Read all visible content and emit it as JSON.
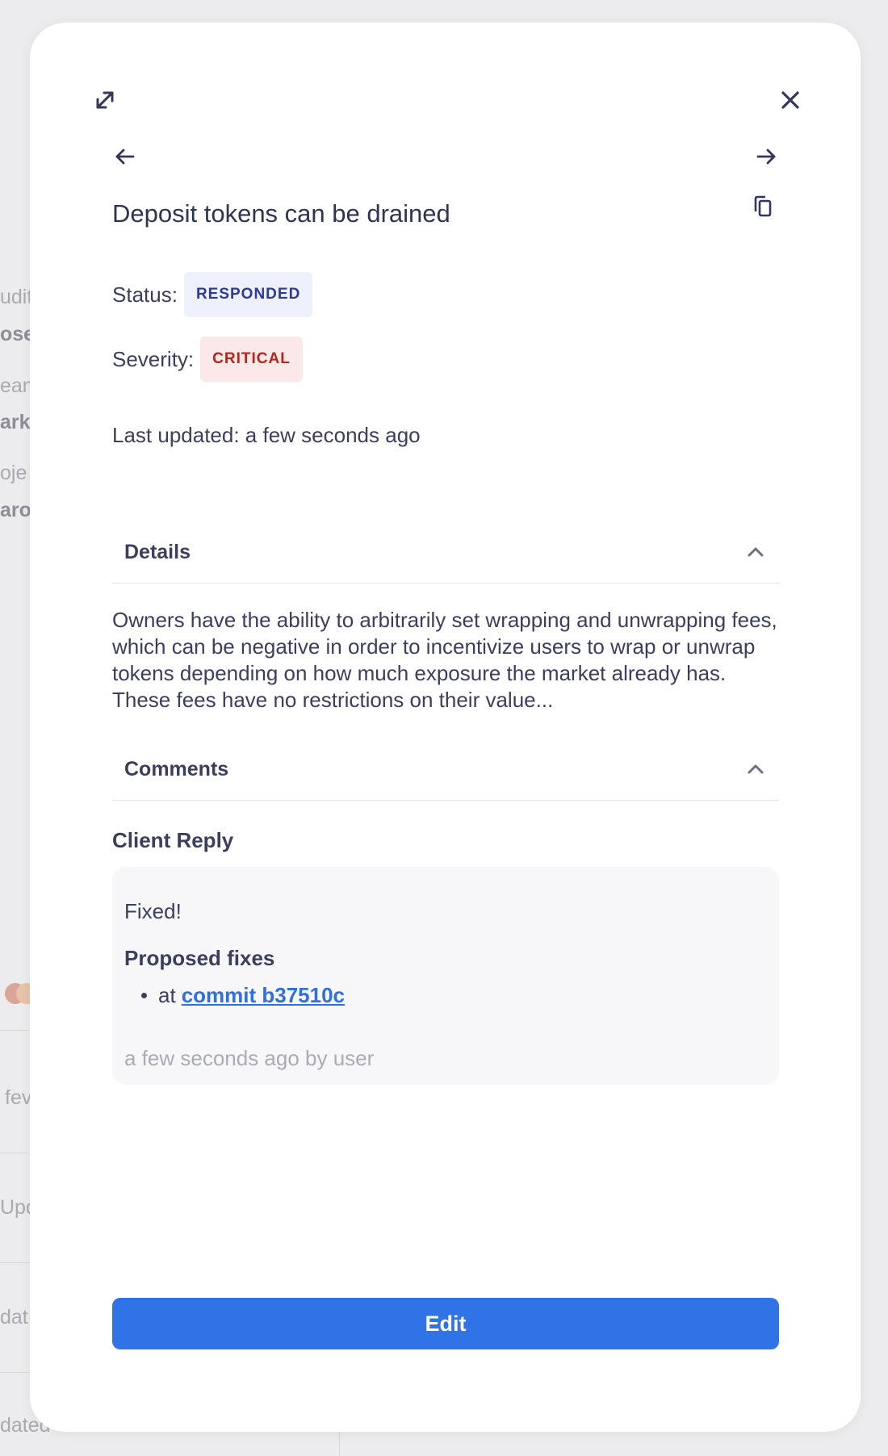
{
  "background": {
    "fragments": [
      "udit",
      "ose",
      "eam",
      "ark",
      "oje",
      "aro",
      "fev",
      "Upd",
      "dat",
      "dated"
    ]
  },
  "modal": {
    "icons": {
      "expand": "expand-icon",
      "close": "close-icon",
      "prev": "arrow-left-icon",
      "next": "arrow-right-icon",
      "copy": "copy-icon"
    },
    "title": "Deposit tokens can be drained",
    "status_label": "Status:",
    "status_value": "RESPONDED",
    "severity_label": "Severity:",
    "severity_value": "CRITICAL",
    "last_updated": "Last updated: a few seconds ago",
    "details": {
      "header": "Details",
      "text": "Owners have the ability to arbitrarily set wrapping and unwrapping fees, which can be negative in order to incentivize users to wrap or unwrap tokens depending on how much exposure the market already has. These fees have no restrictions on their value..."
    },
    "comments": {
      "header": "Comments",
      "reply_title": "Client Reply",
      "reply_text": "Fixed!",
      "fixes_title": "Proposed fixes",
      "fix_prefix": "at",
      "fix_link": "commit b37510c",
      "reply_meta": "a few seconds ago by user"
    },
    "edit_label": "Edit"
  },
  "colors": {
    "accent": "#2f73e6",
    "responded_bg": "#eef0fb",
    "responded_fg": "#2d3a97",
    "critical_bg": "#fbe9e9",
    "critical_fg": "#b3261e"
  }
}
